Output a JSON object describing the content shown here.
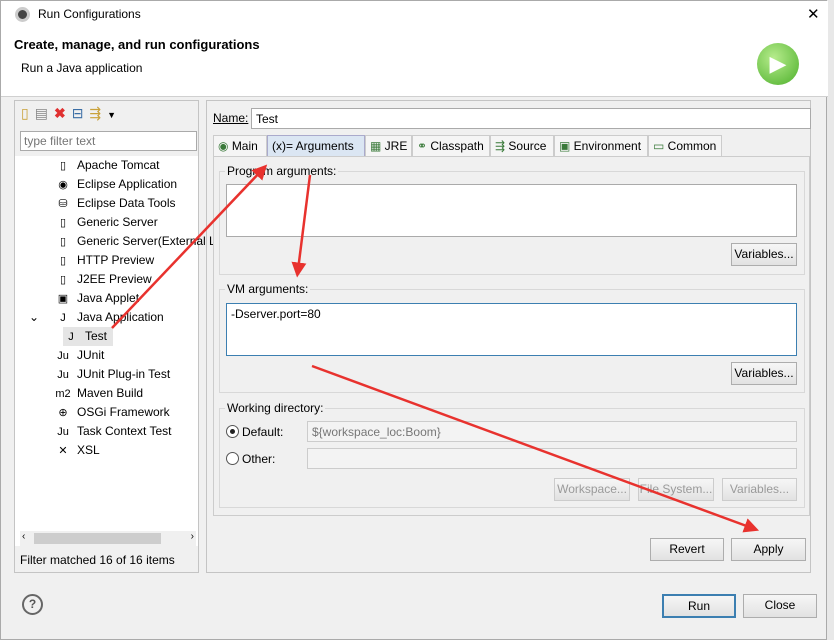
{
  "window": {
    "title": "Run Configurations",
    "close": "✕"
  },
  "header": {
    "title": "Create, manage, and run configurations",
    "subtitle": "Run a Java application"
  },
  "toolbar": {
    "icons": [
      "new-config-icon",
      "duplicate-icon",
      "delete-icon",
      "collapse-all-icon",
      "filter-icon",
      "dropdown-icon"
    ]
  },
  "filter": {
    "placeholder": "type filter text"
  },
  "tree": [
    {
      "label": "Apache Tomcat",
      "icon": "▯"
    },
    {
      "label": "Eclipse Application",
      "icon": "◉"
    },
    {
      "label": "Eclipse Data Tools",
      "icon": "⛁"
    },
    {
      "label": "Generic Server",
      "icon": "▯"
    },
    {
      "label": "Generic Server(External L",
      "icon": "▯"
    },
    {
      "label": "HTTP Preview",
      "icon": "▯"
    },
    {
      "label": "J2EE Preview",
      "icon": "▯"
    },
    {
      "label": "Java Applet",
      "icon": "▣"
    },
    {
      "label": "Java Application",
      "icon": "J",
      "expanded": true
    },
    {
      "label": "Test",
      "icon": "J",
      "child": true,
      "selected": true
    },
    {
      "label": "JUnit",
      "icon": "Ju"
    },
    {
      "label": "JUnit Plug-in Test",
      "icon": "Ju"
    },
    {
      "label": "Maven Build",
      "icon": "m2"
    },
    {
      "label": "OSGi Framework",
      "icon": "⊕"
    },
    {
      "label": "Task Context Test",
      "icon": "Ju"
    },
    {
      "label": "XSL",
      "icon": "✕"
    }
  ],
  "status": "Filter matched 16 of 16 items",
  "name": {
    "label": "Name:",
    "value": "Test"
  },
  "tabs": [
    {
      "label": "Main",
      "icon": "main-icon"
    },
    {
      "label": "(x)= Arguments",
      "icon": "arguments-icon",
      "active": true
    },
    {
      "label": "JRE",
      "icon": "jre-icon"
    },
    {
      "label": "Classpath",
      "icon": "classpath-icon"
    },
    {
      "label": "Source",
      "icon": "source-icon"
    },
    {
      "label": "Environment",
      "icon": "environment-icon"
    },
    {
      "label": "Common",
      "icon": "common-icon"
    }
  ],
  "program_args": {
    "label": "Program arguments:",
    "value": "",
    "variables": "Variables..."
  },
  "vm_args": {
    "label": "VM arguments:",
    "value": "-Dserver.port=80",
    "variables": "Variables..."
  },
  "working_dir": {
    "label": "Working directory:",
    "default_label": "Default:",
    "default_value": "${workspace_loc:Boom}",
    "default_checked": true,
    "other_label": "Other:",
    "other_value": "",
    "workspace": "Workspace...",
    "file_system": "File System...",
    "variables": "Variables..."
  },
  "buttons": {
    "revert": "Revert",
    "apply": "Apply",
    "run": "Run",
    "close": "Close",
    "help": "?"
  },
  "colors": {
    "accent": "#3c7fb1",
    "arrow": "#e8322e",
    "run_icon": "#4caf2a"
  }
}
